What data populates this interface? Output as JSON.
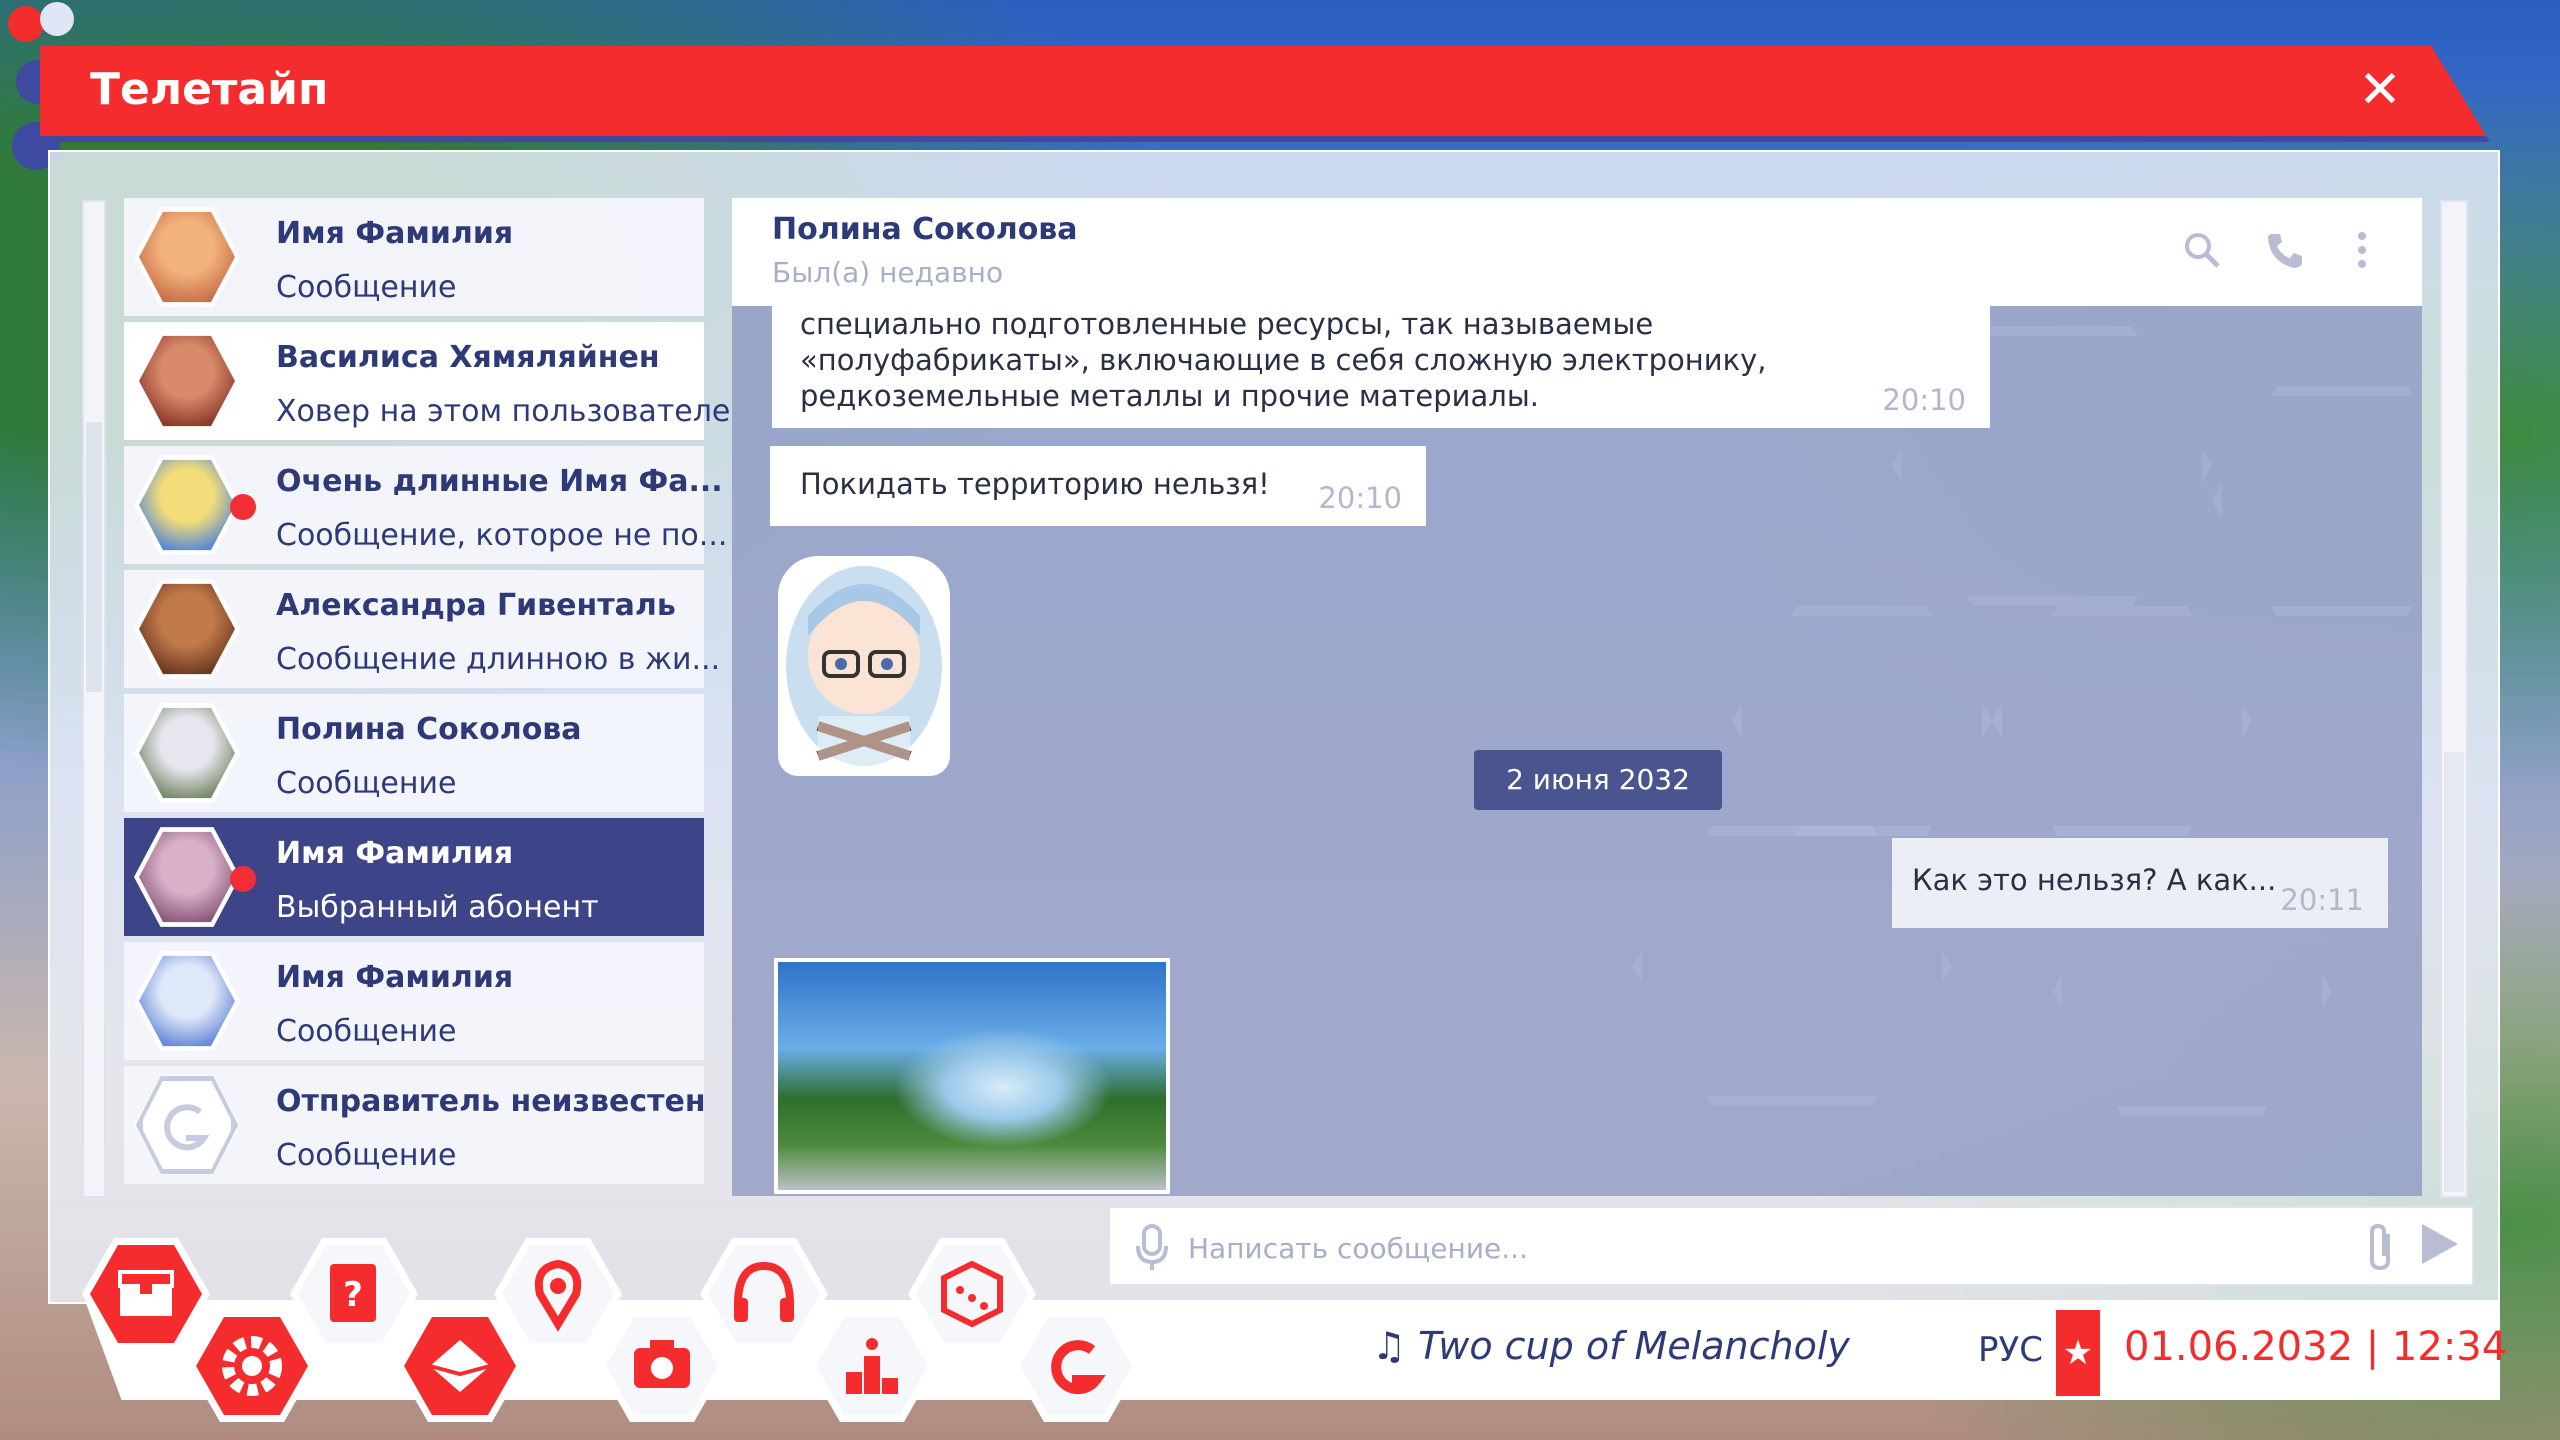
{
  "window": {
    "title": "Телетайп",
    "close_glyph": "✕"
  },
  "contacts": [
    {
      "name": "Имя Фамилия",
      "message": "Сообщение",
      "state": "normal",
      "unread": false,
      "avatar_colors": [
        "#f2b27c",
        "#c9704a"
      ]
    },
    {
      "name": "Василиса Хямяляйнен",
      "message": "Ховер на этом пользователе",
      "state": "hover",
      "unread": false,
      "avatar_colors": [
        "#d88a6a",
        "#8c3a2a"
      ]
    },
    {
      "name": "Очень длинные Имя Фа...",
      "message": "Сообщение, которое не по...",
      "state": "normal",
      "unread": true,
      "avatar_colors": [
        "#f3dd7a",
        "#5a8ad0"
      ]
    },
    {
      "name": "Александра Гивенталь",
      "message": "Сообщение длинною в жи...",
      "state": "normal",
      "unread": false,
      "avatar_colors": [
        "#c27a4a",
        "#6b3a22"
      ]
    },
    {
      "name": "Полина Соколова",
      "message": "Сообщение",
      "state": "normal",
      "unread": false,
      "avatar_colors": [
        "#e6e6ee",
        "#7a8a6a"
      ]
    },
    {
      "name": "Имя Фамилия",
      "message": "Выбранный абонент",
      "state": "selected",
      "unread": true,
      "avatar_colors": [
        "#d8b0c8",
        "#8a5a7a"
      ]
    },
    {
      "name": "Имя Фамилия",
      "message": "Сообщение",
      "state": "normal",
      "unread": false,
      "avatar_colors": [
        "#dfe8f8",
        "#6a8ad8"
      ]
    },
    {
      "name": "Отправитель неизвестен",
      "message": "Сообщение",
      "state": "normal",
      "unread": false,
      "avatar_colors": [
        "#ffffff",
        "#ffffff"
      ]
    }
  ],
  "chat": {
    "name": "Полина Соколова",
    "status": "Был(а) недавно",
    "messages": [
      {
        "text": "специально подготовленные ресурсы, так называемые «полуфабрикаты», включающие в себя сложную электронику, редкоземельные металлы и прочие материалы.",
        "time": "20:10"
      },
      {
        "text": "Покидать территорию нельзя!",
        "time": "20:10"
      },
      {
        "text": "Как это нельзя? А как...",
        "time": "20:11"
      }
    ],
    "date_separator": "2 июня 2032"
  },
  "input": {
    "placeholder": "Написать сообщение..."
  },
  "taskbar": {
    "music": "♫ Two cup of Melancholy",
    "language": "РУС",
    "datetime": "01.06.2032 | 12:34"
  },
  "colors": {
    "accent_red": "#f52c2e",
    "navy": "#2e3a78",
    "selected_bg": "#3d4488"
  },
  "icons": {
    "search": "search-icon",
    "call": "phone-icon",
    "menu": "more-vertical-icon",
    "mic": "microphone-icon",
    "attach": "paperclip-icon",
    "send": "send-icon",
    "dock": [
      "inventory-icon",
      "settings-icon",
      "help-book-icon",
      "mail-icon",
      "map-pin-icon",
      "camera-icon",
      "headphones-icon",
      "ranking-icon",
      "dice-icon",
      "logo-icon"
    ]
  }
}
